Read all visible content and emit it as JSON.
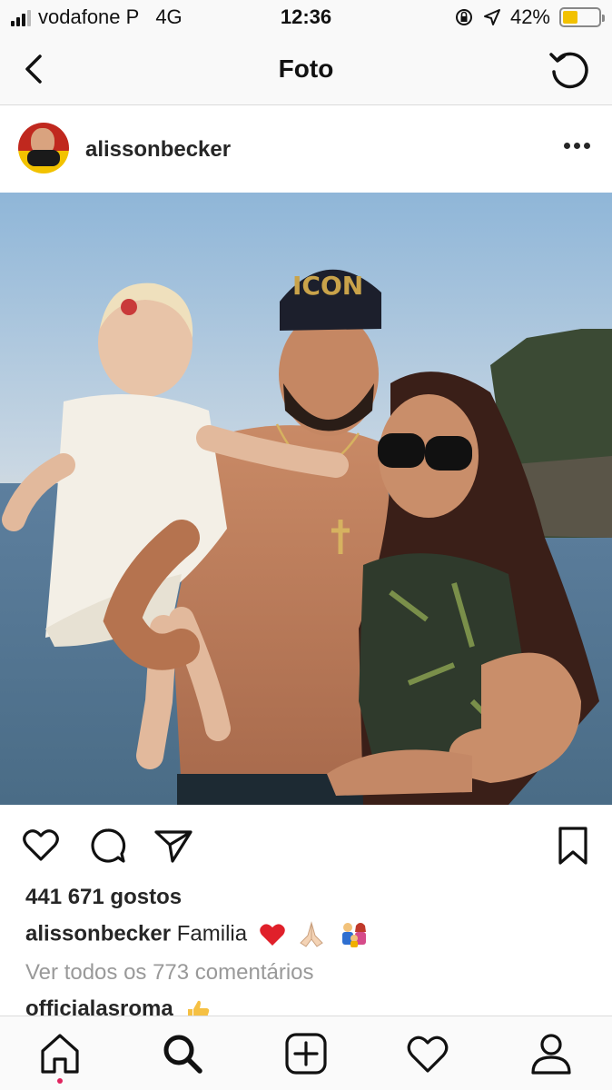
{
  "status_bar": {
    "carrier": "vodafone P",
    "network": "4G",
    "time": "12:36",
    "battery": "42%",
    "battery_level": 0.42,
    "icons": [
      "signal-bars-icon",
      "orientation-lock-icon",
      "location-arrow-icon",
      "battery-icon"
    ]
  },
  "header": {
    "title": "Foto",
    "back_icon": "chevron-left-icon",
    "refresh_icon": "refresh-icon"
  },
  "post": {
    "username": "alissonbecker",
    "more_icon": "more-dots-icon",
    "photo_description_icon": "post-photo",
    "likes": "441 671 gostos",
    "caption_user": "alissonbecker",
    "caption_text": "Familia",
    "caption_emojis": [
      "heart-emoji",
      "praying-hands-emoji",
      "family-emoji"
    ],
    "view_comments": "Ver todos os 773 comentários",
    "first_comment_user": "officialasroma",
    "first_comment_emoji": "thumbs-up-emoji"
  },
  "actions": {
    "icons": [
      "heart-icon",
      "comment-icon",
      "share-icon",
      "bookmark-icon"
    ]
  },
  "tabbar": {
    "icons": [
      "home-icon",
      "search-icon",
      "add-post-icon",
      "activity-heart-icon",
      "profile-icon"
    ],
    "active": "home-icon",
    "accent": "#e0245e"
  }
}
